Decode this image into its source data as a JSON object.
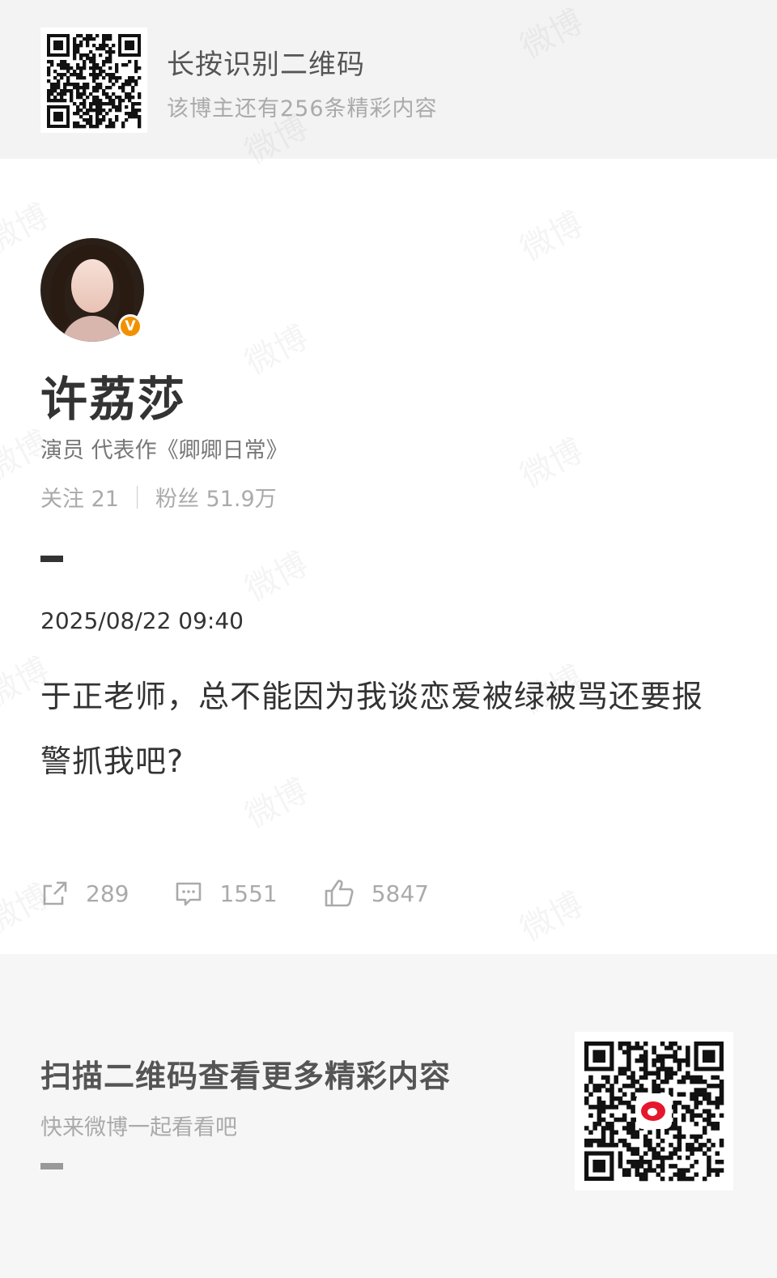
{
  "top_banner": {
    "title": "长按识别二维码",
    "subtitle": "该博主还有256条精彩内容",
    "qr_icon": "qr-code"
  },
  "profile": {
    "name": "许荔莎",
    "bio": "演员 代表作《卿卿日常》",
    "following_label": "关注 21",
    "followers_label": "粉丝 51.9万",
    "verified_badge": "V",
    "verified_color": "#f29100"
  },
  "post": {
    "timestamp": "2025/08/22 09:40",
    "text": "于正老师，总不能因为我谈恋爱被绿被骂还要报警抓我吧?",
    "reposts": "289",
    "comments": "1551",
    "likes": "5847",
    "icons": [
      "repost-icon",
      "comment-icon",
      "like-icon"
    ]
  },
  "bottom": {
    "title": "扫描二维码查看更多精彩内容",
    "subtitle": "快来微博一起看看吧",
    "qr_icon": "qr-code",
    "logo_icon": "weibo-logo"
  },
  "watermark": {
    "text": "微博"
  },
  "colors": {
    "text_primary": "#333333",
    "text_secondary": "#777777",
    "text_muted": "#aaaaaa",
    "brand_red": "#e6162d"
  }
}
